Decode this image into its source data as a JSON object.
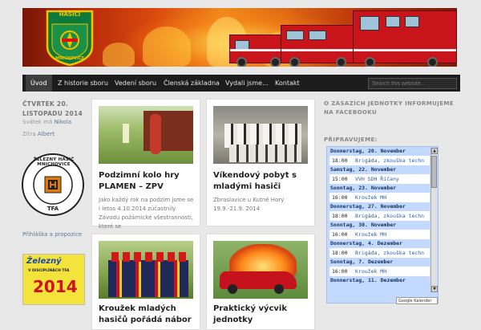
{
  "header": {
    "logo_text_top": "HASIČI",
    "logo_text_bottom": "MNICHOVICE"
  },
  "nav": {
    "items": [
      {
        "label": "Úvod",
        "active": true
      },
      {
        "label": "Z historie sboru"
      },
      {
        "label": "Vedení sboru"
      },
      {
        "label": "Členská základna"
      },
      {
        "label": "Vydali jsme..."
      },
      {
        "label": "Kontakt"
      }
    ]
  },
  "search": {
    "placeholder": "Search this website..."
  },
  "sidebar": {
    "date": [
      "ČTVRTEK 20.",
      "LISTOPADU 2014"
    ],
    "nameday_today_prefix": "Svátek má",
    "nameday_today": "Nikola",
    "nameday_tomorrow_prefix": "Zítra",
    "nameday_tomorrow": "Albert",
    "badge_top": "ŽELEZNÝ HASIČ MNICHOVICE",
    "badge_bottom": "TFA",
    "link": "Přihláška a propozice",
    "poster": {
      "top": "Železný",
      "sub": "V DISCIPLÍNÁCH TFA",
      "year": "2014"
    }
  },
  "posts": [
    {
      "title": "Podzimní kolo hry PLAMEN – ZPV",
      "excerpt": "Jako každý rok na podzim jsme se i letos 4.10.2014 zúčastnily Závodu požárnické všestrannosti, které se"
    },
    {
      "title": "Víkendový pobyt s mladými hasiči",
      "excerpt": "Zbraslavice u Kutné Hory 19.9.-21.9. 2014"
    },
    {
      "title": "Kroužek mladých hasičů pořádá nábor",
      "excerpt": ""
    },
    {
      "title": "Praktický výcvik jednotky",
      "excerpt": ""
    }
  ],
  "right": {
    "heading": "O ZÁSAZÍCH JEDNOTKY INFORMUJEME NA FACEBOOKU",
    "cal_heading": "PŘIPRAVUJEME:",
    "calendar": [
      {
        "day": "Donnerstag, 20. November",
        "events": [
          {
            "time": "18:00",
            "name": "Brigáda, zkouška techn"
          }
        ]
      },
      {
        "day": "Samstag, 22. November",
        "events": [
          {
            "time": "15:00",
            "name": "VVH SDH Říčany"
          }
        ]
      },
      {
        "day": "Sonntag, 23. November",
        "events": [
          {
            "time": "16:00",
            "name": "Kroužek MH"
          }
        ]
      },
      {
        "day": "Donnerstag, 27. November",
        "events": [
          {
            "time": "18:00",
            "name": "Brigáda, zkouška techn"
          }
        ]
      },
      {
        "day": "Sonntag, 30. November",
        "events": [
          {
            "time": "16:00",
            "name": "Kroužek MH"
          }
        ]
      },
      {
        "day": "Donnerstag, 4. Dezember",
        "events": [
          {
            "time": "18:00",
            "name": "Brigáda, zkouška techn"
          }
        ]
      },
      {
        "day": "Sonntag, 7. Dezember",
        "events": [
          {
            "time": "16:00",
            "name": "Kroužek MH"
          }
        ]
      },
      {
        "day": "Donnerstag, 11. Dezember",
        "events": []
      }
    ],
    "gcal_label": "Google Kalender"
  }
}
